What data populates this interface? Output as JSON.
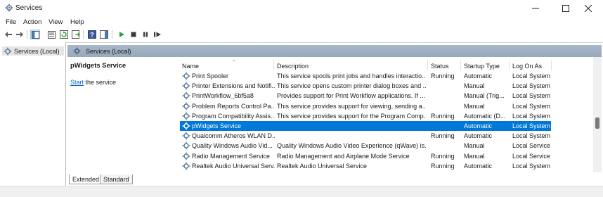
{
  "window": {
    "title": "Services",
    "app_icon": "services-gear-icon"
  },
  "menu": [
    "File",
    "Action",
    "View",
    "Help"
  ],
  "toolbar": {
    "icons": [
      "back-arrow-icon",
      "forward-arrow-icon",
      "show-hide-console-tree-icon",
      "properties-icon",
      "refresh-icon",
      "export-list-icon",
      "help-icon",
      "show-action-pane-icon",
      "start-icon",
      "stop-icon",
      "pause-icon",
      "restart-icon"
    ]
  },
  "tree": {
    "selected_label": "Services (Local)"
  },
  "header": {
    "label": "Services (Local)"
  },
  "detail": {
    "service_name": "pWidgets Service",
    "action_link": "Start",
    "action_rest": " the service"
  },
  "columns": [
    "Name",
    "Description",
    "Status",
    "Startup Type",
    "Log On As"
  ],
  "rows": [
    {
      "name": "Print Spooler",
      "description": "This service spools print jobs and handles interactio...",
      "status": "Running",
      "startup": "Automatic",
      "logon": "Local System"
    },
    {
      "name": "Printer Extensions and Notifi...",
      "description": "This service opens custom printer dialog boxes and ...",
      "status": "",
      "startup": "Manual",
      "logon": "Local System"
    },
    {
      "name": "PrintWorkflow_6bf5a8",
      "description": "Provides support for Print Workflow applications. If ...",
      "status": "",
      "startup": "Manual (Trig...",
      "logon": "Local System"
    },
    {
      "name": "Problem Reports Control Pa...",
      "description": "This service provides support for viewing, sending a...",
      "status": "",
      "startup": "Manual",
      "logon": "Local System"
    },
    {
      "name": "Program Compatibility Assis...",
      "description": "This service provides support for the Program Comp...",
      "status": "Running",
      "startup": "Automatic (D...",
      "logon": "Local System"
    },
    {
      "name": "pWidgets Service",
      "description": "",
      "status": "",
      "startup": "Automatic",
      "logon": "Local System"
    },
    {
      "name": "Qualcomm Atheros WLAN D...",
      "description": "",
      "status": "Running",
      "startup": "Automatic",
      "logon": "Local System"
    },
    {
      "name": "Quality Windows Audio Vid...",
      "description": "Quality Windows Audio Video Experience (qWave) is...",
      "status": "",
      "startup": "Manual",
      "logon": "Local Service"
    },
    {
      "name": "Radio Management Service",
      "description": "Radio Management and Airplane Mode Service",
      "status": "Running",
      "startup": "Manual",
      "logon": "Local Service"
    },
    {
      "name": "Realtek Audio Universal Serv...",
      "description": "Realtek Audio Universal Service",
      "status": "Running",
      "startup": "Automatic",
      "logon": "Local System"
    }
  ],
  "selected_row_index": 5,
  "tabs": [
    "Extended",
    "Standard"
  ],
  "colors": {
    "selection": "#0078d7",
    "header_band": "#a3b3c6",
    "link": "#0066cc"
  }
}
